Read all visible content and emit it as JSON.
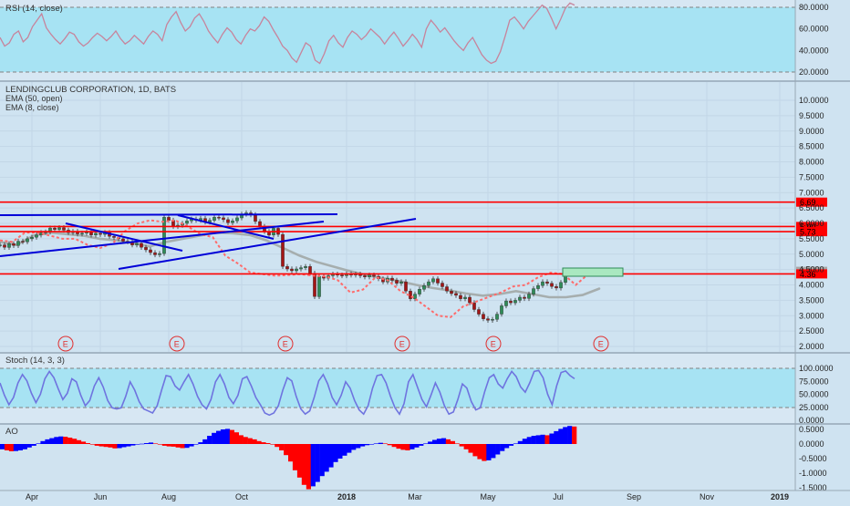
{
  "chart_data": {
    "type": "candlestick",
    "rsi": {
      "title": "RSI (14, close)",
      "ticks": [
        "80.0000",
        "60.0000",
        "40.0000",
        "20.0000"
      ],
      "values": [
        52,
        44,
        47,
        55,
        58,
        48,
        52,
        62,
        68,
        74,
        61,
        55,
        50,
        46,
        51,
        57,
        55,
        48,
        44,
        47,
        52,
        56,
        53,
        49,
        53,
        58,
        51,
        46,
        49,
        54,
        50,
        46,
        53,
        58,
        55,
        49,
        64,
        71,
        76,
        66,
        58,
        62,
        70,
        74,
        67,
        58,
        52,
        47,
        55,
        61,
        57,
        50,
        46,
        54,
        60,
        58,
        63,
        71,
        67,
        59,
        52,
        44,
        40,
        33,
        29,
        38,
        47,
        44,
        31,
        28,
        37,
        49,
        54,
        47,
        43,
        52,
        58,
        55,
        50,
        54,
        60,
        56,
        52,
        46,
        52,
        57,
        51,
        44,
        49,
        55,
        50,
        43,
        60,
        68,
        63,
        57,
        61,
        55,
        49,
        44,
        40,
        47,
        52,
        44,
        36,
        31,
        28,
        30,
        39,
        53,
        68,
        71,
        66,
        60,
        67,
        72,
        77,
        82,
        79,
        70,
        60,
        69,
        79,
        84,
        82
      ]
    },
    "price": {
      "title": "LENDINGCLUB CORPORATION, 1D, BATS",
      "ema_labels": [
        "EMA (50, open)",
        "EMA (8, close)"
      ],
      "ticks": [
        "10.0000",
        "9.5000",
        "9.0000",
        "8.5000",
        "8.0000",
        "7.5000",
        "7.0000",
        "6.5000",
        "6.0000",
        "5.5000",
        "5.0000",
        "4.5000",
        "4.0000",
        "3.5000",
        "3.0000",
        "2.5000",
        "2.0000"
      ],
      "closes": [
        5.3,
        5.22,
        5.34,
        5.28,
        5.42,
        5.4,
        5.5,
        5.55,
        5.62,
        5.7,
        5.72,
        5.85,
        5.8,
        5.86,
        5.78,
        5.7,
        5.74,
        5.66,
        5.68,
        5.72,
        5.62,
        5.68,
        5.64,
        5.7,
        5.58,
        5.54,
        5.5,
        5.42,
        5.4,
        5.3,
        5.35,
        5.22,
        5.14,
        5.05,
        4.98,
        5.02,
        6.2,
        6.1,
        5.9,
        5.94,
        6.0,
        6.08,
        6.14,
        6.1,
        6.16,
        6.04,
        6.1,
        6.2,
        6.18,
        6.12,
        6.02,
        6.08,
        6.18,
        6.3,
        6.34,
        6.28,
        6.06,
        5.9,
        5.74,
        5.62,
        5.84,
        5.64,
        4.6,
        4.52,
        4.46,
        4.52,
        4.56,
        4.6,
        4.38,
        3.62,
        4.28,
        4.22,
        4.3,
        4.35,
        4.32,
        4.3,
        4.36,
        4.32,
        4.35,
        4.3,
        4.26,
        4.32,
        4.28,
        4.2,
        4.1,
        4.22,
        4.15,
        4.05,
        4.1,
        3.8,
        3.55,
        3.7,
        3.86,
        3.98,
        4.1,
        4.2,
        4.06,
        3.94,
        3.8,
        3.72,
        3.66,
        3.55,
        3.6,
        3.42,
        3.2,
        3.05,
        2.9,
        2.85,
        2.88,
        3.05,
        3.32,
        3.48,
        3.42,
        3.5,
        3.6,
        3.56,
        3.7,
        3.88,
        3.98,
        4.1,
        4.05,
        3.95,
        3.9,
        4.08,
        4.45,
        4.42,
        4.4
      ],
      "ema50_open": [
        5.4,
        5.3,
        5.6,
        5.7,
        5.65,
        5.6,
        5.5,
        5.45,
        5.35,
        5.25,
        5.4,
        5.5,
        5.6,
        5.7,
        5.68,
        5.62,
        5.45,
        5.2,
        4.95,
        4.75,
        4.6,
        4.45,
        4.32,
        4.22,
        4.12,
        4.0,
        3.9,
        3.82,
        3.72,
        3.65,
        3.7,
        3.8,
        3.7,
        3.6,
        3.6,
        3.67,
        3.88
      ],
      "ema8_close": [
        5.45,
        5.4,
        5.7,
        5.7,
        5.6,
        5.5,
        5.5,
        5.3,
        5.2,
        5.35,
        5.75,
        6.0,
        6.1,
        6.05,
        6.1,
        5.9,
        5.65,
        5.55,
        4.95,
        4.7,
        4.4,
        4.35,
        4.3,
        4.32,
        4.35,
        4.3,
        4.28,
        4.15,
        3.75,
        3.85,
        4.25,
        4.15,
        3.8,
        3.6,
        3.3,
        3.0,
        2.95,
        3.3,
        3.45,
        3.6,
        3.75,
        3.95,
        4.0,
        4.25,
        4.4,
        4.35,
        4.0,
        4.35
      ],
      "levels": [
        {
          "value": 6.69,
          "label": "6.69",
          "color": "#ff0000"
        },
        {
          "value": 5.9,
          "label": "5.90",
          "color": "#ff0000"
        },
        {
          "value": 5.73,
          "label": "5.73",
          "color": "#ff0000"
        },
        {
          "value": 4.44,
          "label": "4.44",
          "color": "#a6a6a6"
        },
        {
          "value": 4.36,
          "label": "4.36",
          "color": "#ff0000"
        }
      ],
      "earnings_marker": "E"
    },
    "stoch": {
      "title": "Stoch (14, 3, 3)",
      "ticks": [
        "100.0000",
        "75.0000",
        "50.0000",
        "25.0000",
        "0.0000"
      ],
      "values": [
        72,
        48,
        30,
        44,
        72,
        88,
        76,
        52,
        34,
        50,
        80,
        94,
        82,
        60,
        40,
        52,
        80,
        74,
        48,
        28,
        38,
        66,
        82,
        64,
        38,
        24,
        22,
        24,
        46,
        74,
        58,
        36,
        22,
        18,
        14,
        28,
        58,
        86,
        84,
        66,
        58,
        74,
        88,
        70,
        46,
        30,
        22,
        40,
        74,
        88,
        70,
        44,
        32,
        48,
        80,
        84,
        66,
        44,
        30,
        14,
        10,
        14,
        28,
        58,
        82,
        76,
        46,
        22,
        12,
        18,
        44,
        76,
        88,
        70,
        44,
        30,
        48,
        74,
        62,
        38,
        20,
        12,
        28,
        62,
        86,
        88,
        72,
        46,
        24,
        12,
        32,
        74,
        88,
        64,
        40,
        26,
        48,
        72,
        54,
        28,
        12,
        16,
        40,
        70,
        62,
        36,
        20,
        24,
        56,
        82,
        88,
        70,
        62,
        80,
        94,
        84,
        64,
        54,
        72,
        94,
        96,
        82,
        50,
        30,
        66,
        92,
        95,
        86,
        80
      ]
    },
    "ao": {
      "title": "AO",
      "ticks": [
        "0.5000",
        "0.0000",
        "-0.5000",
        "-1.0000",
        "-1.5000"
      ],
      "values": [
        -0.18,
        -0.22,
        -0.25,
        -0.24,
        -0.22,
        -0.18,
        -0.12,
        -0.06,
        0.02,
        0.1,
        0.16,
        0.2,
        0.24,
        0.26,
        0.25,
        0.22,
        0.18,
        0.13,
        0.08,
        0.03,
        -0.02,
        -0.06,
        -0.08,
        -0.1,
        -0.12,
        -0.15,
        -0.14,
        -0.11,
        -0.08,
        -0.05,
        -0.02,
        0.01,
        0.03,
        0.05,
        0.02,
        -0.02,
        -0.06,
        -0.08,
        -0.09,
        -0.12,
        -0.14,
        -0.13,
        -0.08,
        -0.02,
        0.06,
        0.16,
        0.28,
        0.38,
        0.45,
        0.5,
        0.52,
        0.48,
        0.4,
        0.3,
        0.24,
        0.2,
        0.16,
        0.1,
        0.06,
        0.03,
        -0.02,
        -0.1,
        -0.22,
        -0.38,
        -0.6,
        -0.9,
        -1.15,
        -1.4,
        -1.55,
        -1.45,
        -1.3,
        -1.1,
        -0.95,
        -0.8,
        -0.62,
        -0.5,
        -0.4,
        -0.3,
        -0.2,
        -0.14,
        -0.08,
        -0.04,
        0.0,
        0.02,
        0.04,
        0.02,
        -0.04,
        -0.1,
        -0.16,
        -0.2,
        -0.22,
        -0.18,
        -0.12,
        -0.06,
        0.02,
        0.08,
        0.14,
        0.18,
        0.2,
        0.16,
        0.1,
        0.02,
        -0.08,
        -0.18,
        -0.3,
        -0.42,
        -0.52,
        -0.58,
        -0.56,
        -0.48,
        -0.36,
        -0.24,
        -0.14,
        -0.06,
        0.02,
        0.1,
        0.18,
        0.24,
        0.28,
        0.3,
        0.32,
        0.3,
        0.36,
        0.44,
        0.52,
        0.58,
        0.62,
        0.6
      ],
      "colors": {
        "up": "#0000ff",
        "down": "#ff0000"
      }
    },
    "x_axis": {
      "labels": [
        "Apr",
        "Jun",
        "Aug",
        "Oct",
        "2018",
        "Mar",
        "May",
        "Jul",
        "Sep",
        "Nov",
        "2019"
      ]
    },
    "colors": {
      "band": "#a7e3f3",
      "rsi_line": "#c7849c",
      "stoch_line": "#6f74df",
      "ema50": "#a6aeae",
      "ema8": "#ff6b6b",
      "level": "#ff0000",
      "trend": "#0000d8",
      "candle_up": "#2e8b57",
      "candle_down": "#a31515",
      "target_box": "#a9e8c0"
    }
  }
}
